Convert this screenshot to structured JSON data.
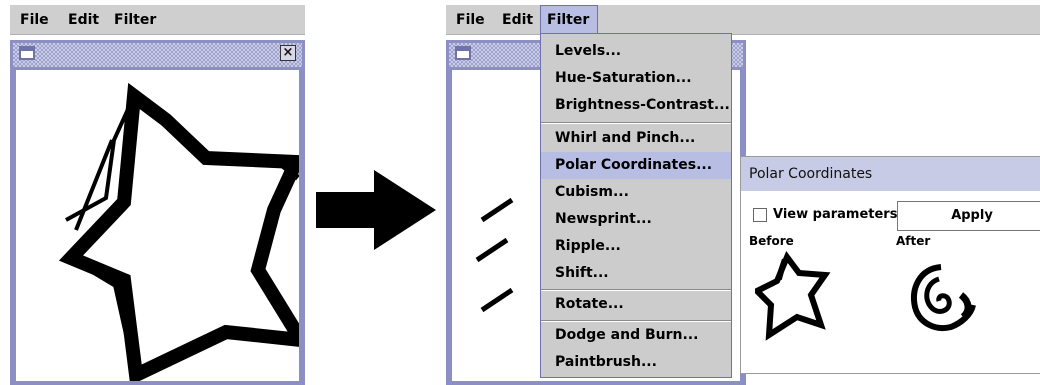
{
  "left_window": {
    "menus": [
      "File",
      "Edit",
      "Filter"
    ]
  },
  "right_window": {
    "menus": [
      "File",
      "Edit",
      "Filter"
    ],
    "active_menu": "Filter",
    "filter_menu": {
      "groups": [
        [
          "Levels...",
          "Hue-Saturation...",
          "Brightness-Contrast..."
        ],
        [
          "Whirl and Pinch...",
          "Polar Coordinates...",
          "Cubism...",
          "Newsprint...",
          "Ripple...",
          "Shift..."
        ],
        [
          "Rotate..."
        ],
        [
          "Dodge and Burn...",
          "Paintbrush..."
        ]
      ],
      "highlighted": "Polar Coordinates..."
    }
  },
  "polar_dialog": {
    "title": "Polar Coordinates",
    "view_parameters_label": "View parameters",
    "view_parameters_checked": false,
    "apply_label": "Apply",
    "before_label": "Before",
    "after_label": "After"
  },
  "colors": {
    "menubar": "#cfcfcf",
    "frame": "#8b8fc3",
    "highlight": "#b8bde3",
    "dialog_title": "#c8cbe5"
  },
  "icons": [
    "window-icon",
    "close-icon",
    "arrow-right-icon"
  ]
}
